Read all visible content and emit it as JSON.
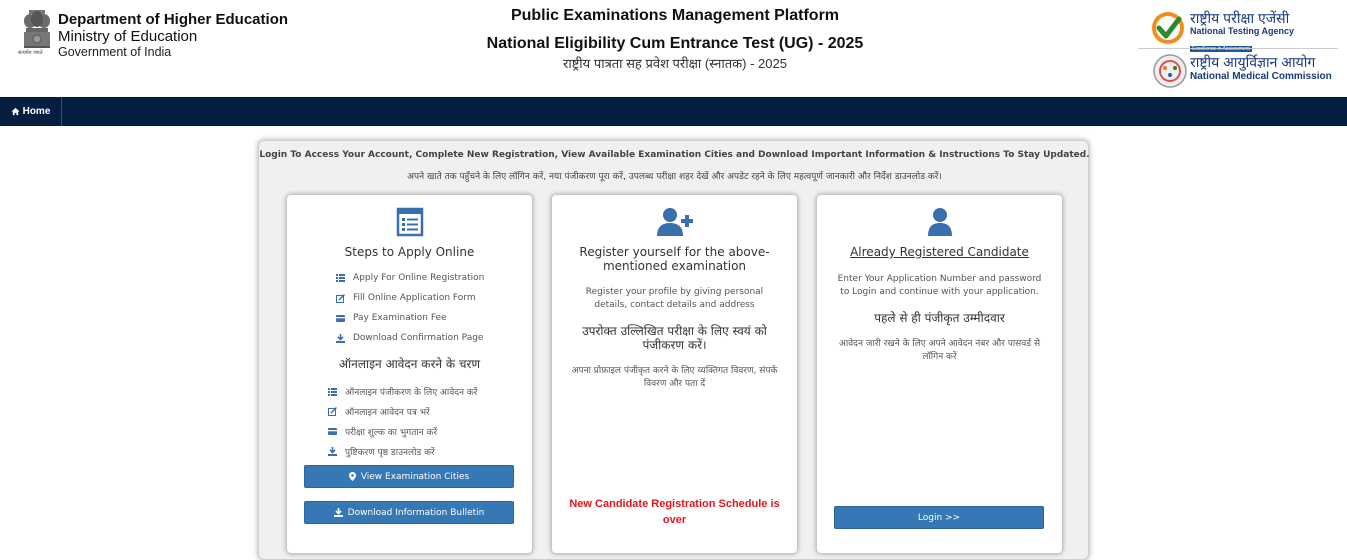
{
  "header": {
    "dept_line1": "Department of Higher Education",
    "dept_line2": "Ministry of Education",
    "dept_line3": "Government of India",
    "emblem_caption": "सत्यमेव जयते",
    "title1": "Public Examinations Management Platform",
    "title2": "National Eligibility Cum Entrance Test (UG) - 2025",
    "title3": "राष्ट्रीय पात्रता सह प्रवेश परीक्षा (स्नातक) - 2025",
    "nta_hindi": "राष्ट्रीय परीक्षा एजेंसी",
    "nta_english": "National Testing Agency",
    "nta_tagline": "Excellence in Assessment",
    "nmc_hindi": "राष्ट्रीय आयुर्विज्ञान आयोग",
    "nmc_english": "National Medical Commission"
  },
  "nav": {
    "home_label": "Home"
  },
  "intro": {
    "english": "Login To Access Your Account, Complete New Registration, View Available Examination Cities and Download Important Information & Instructions To Stay Updated.",
    "hindi": "अपने खाते तक पहुँचने के लिए लॉगिन करें, नया पंजीकरण पूरा करें, उपलब्ध परीक्षा शहर देखें और अपडेट रहने के लिए महत्वपूर्ण जानकारी और निर्देश डाउनलोड करें।"
  },
  "card1": {
    "title": "Steps to Apply Online",
    "steps": [
      "Apply For Online Registration",
      "Fill Online Application Form",
      "Pay Examination Fee",
      "Download Confirmation Page"
    ],
    "hindi_title": "ऑनलाइन आवेदन करने के चरण",
    "hindi_steps": [
      "ऑनलाइन पंजीकरण के लिए आवेदन करें",
      "ऑनलाइन आवेदन पत्र भरें",
      "परीक्षा शुल्क का भुगतान करें",
      "पुष्टिकरण पृष्ठ डाउनलोड करें"
    ],
    "btn_cities": "View Examination Cities",
    "btn_bulletin": "Download Information Bulletin"
  },
  "card2": {
    "title": "Register yourself for the above-mentioned examination",
    "desc": "Register your profile by giving personal details, contact details and address",
    "hindi_title": "उपरोक्त उल्लिखित परीक्षा के लिए स्वयं को पंजीकरण करें।",
    "hindi_desc": "अपना प्रोफ़ाइल पंजीकृत करने के लिए व्यक्तिगत विवरण, संपर्क विवरण और पता दें",
    "notice": "New Candidate Registration Schedule is over"
  },
  "card3": {
    "title": "Already Registered Candidate",
    "desc": "Enter Your Application Number and password to Login and continue with your application.",
    "hindi_title": "पहले से ही पंजीकृत उम्मीदवार",
    "hindi_desc": "आवेदन जारी रखने के लिए अपने आवेदन नंबर और पासवर्ड से लॉगिन करें",
    "btn_login": "Login >>"
  },
  "colors": {
    "nav_bg": "#041e42",
    "button_bg": "#3677b5",
    "icon_blue": "#3a6fad",
    "notice_red": "#e0161c"
  }
}
